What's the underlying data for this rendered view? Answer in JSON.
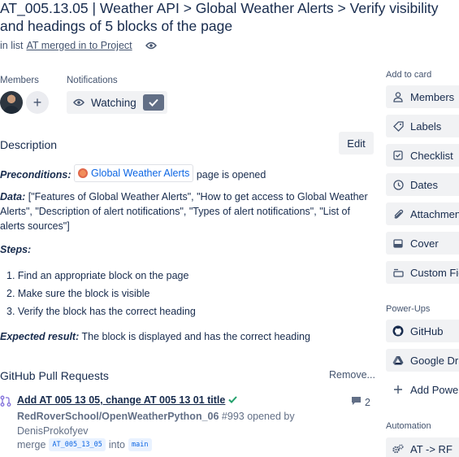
{
  "card": {
    "title_line1": "AT_005.13.05 | Weather API > Global Weather Alerts > Verify visibility",
    "title_line2": "and headings of 5 blocks of the page",
    "in_list_prefix": "in list",
    "list_name": "AT merged in to Project"
  },
  "members": {
    "label": "Members",
    "add_symbol": "+"
  },
  "notifications": {
    "label": "Notifications",
    "watch_label": "Watching"
  },
  "description": {
    "heading": "Description",
    "edit_label": "Edit",
    "preconditions_label": "Preconditions:",
    "preconditions_link": "Global Weather Alerts",
    "preconditions_rest": "page is opened",
    "data_label": "Data:",
    "data_text": "[\"Features of Global Weather Alerts\", \"How to get access to Global Weather Alerts\", \"Description of alert notifications\", \"Types of alert notifications\", \"List of alerts sources\"]",
    "steps_label": "Steps:",
    "steps": [
      "1. Find an appropriate block on the page",
      "2. Make sure the block is visible",
      "3. Verify the block has the correct heading"
    ],
    "expected_label": "Expected result:",
    "expected_text": "The block is displayed and has the correct heading"
  },
  "github": {
    "heading": "GitHub Pull Requests",
    "remove_label": "Remove...",
    "pr": {
      "title": "Add AT 005 13 05, change AT 005 13 01 title",
      "repo": "RedRoverSchool/OpenWeatherPython_06",
      "number_text": "#993 opened by",
      "author": "DenisProkofyev",
      "merge_word": "merge",
      "source_branch": "AT_005_13_05",
      "into_word": "into",
      "target_branch": "main",
      "comment_count": "2"
    }
  },
  "sidebar": {
    "add_to_card_label": "Add to card",
    "add_to_card": [
      {
        "label": "Members",
        "icon": "person-icon"
      },
      {
        "label": "Labels",
        "icon": "tag-icon"
      },
      {
        "label": "Checklist",
        "icon": "checklist-icon"
      },
      {
        "label": "Dates",
        "icon": "clock-icon"
      },
      {
        "label": "Attachment",
        "icon": "paperclip-icon"
      },
      {
        "label": "Cover",
        "icon": "cover-icon"
      },
      {
        "label": "Custom Fields",
        "icon": "custom-fields-icon"
      }
    ],
    "powerups_label": "Power-Ups",
    "powerups": [
      {
        "label": "GitHub",
        "icon": "github-icon"
      },
      {
        "label": "Google Drive",
        "icon": "google-drive-icon"
      },
      {
        "label": "Add Power-Ups",
        "icon": "plus-icon"
      }
    ],
    "automation_label": "Automation",
    "automation": [
      {
        "label": "AT -> RF",
        "icon": "gears-icon"
      }
    ]
  },
  "colors": {
    "link": "#0c66e4",
    "text": "#172b4d",
    "muted": "#44546f",
    "button_bg": "#f1f2f4",
    "watch_check_bg": "#626f86",
    "success": "#22a06b"
  }
}
